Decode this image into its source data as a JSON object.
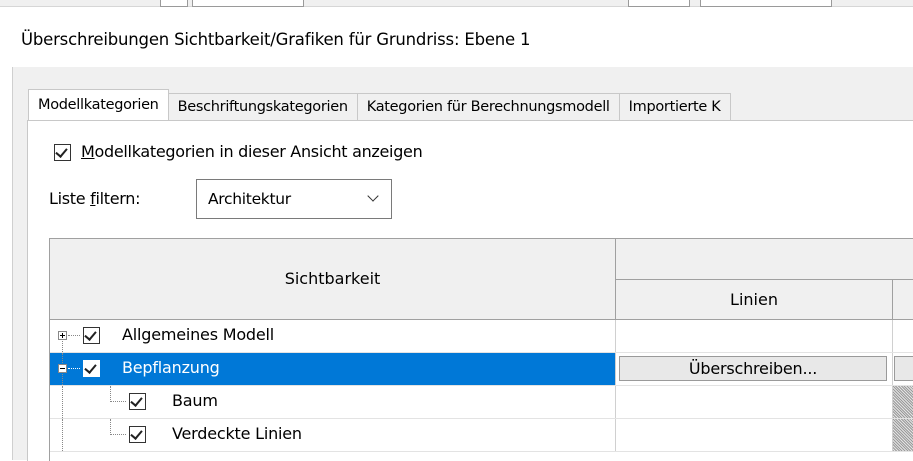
{
  "dialog": {
    "title": "Überschreibungen Sichtbarkeit/Grafiken für Grundriss: Ebene 1"
  },
  "tabs": [
    {
      "label": "Modellkategorien",
      "active": true
    },
    {
      "label": "Beschriftungskategorien",
      "active": false
    },
    {
      "label": "Kategorien für Berechnungsmodell",
      "active": false
    },
    {
      "label": "Importierte K",
      "active": false
    }
  ],
  "show_categories": {
    "label_accel": "M",
    "label_rest": "odellkategorien in dieser Ansicht anzeigen",
    "checked": true
  },
  "filter": {
    "label_pre": "Liste ",
    "label_accel": "f",
    "label_post": "iltern:",
    "value": "Architektur",
    "chevron_icon": "chevron-down-icon"
  },
  "table": {
    "header_visibility": "Sichtbarkeit",
    "header_lines": "Linien",
    "rows": [
      {
        "label": "Allgemeines Modell",
        "checked": true,
        "expand": "+",
        "selected": false,
        "lines_cell": ""
      },
      {
        "label": "Bepflanzung",
        "checked": true,
        "expand": "-",
        "selected": true,
        "lines_cell": "Überschreiben..."
      },
      {
        "label": "Baum",
        "checked": true,
        "expand": "",
        "selected": false,
        "lines_cell": ""
      },
      {
        "label": "Verdeckte Linien",
        "checked": true,
        "expand": "",
        "selected": false,
        "lines_cell": ""
      }
    ]
  },
  "colors": {
    "selection": "#0078d7",
    "dialog_bg": "#f0f0f0"
  }
}
